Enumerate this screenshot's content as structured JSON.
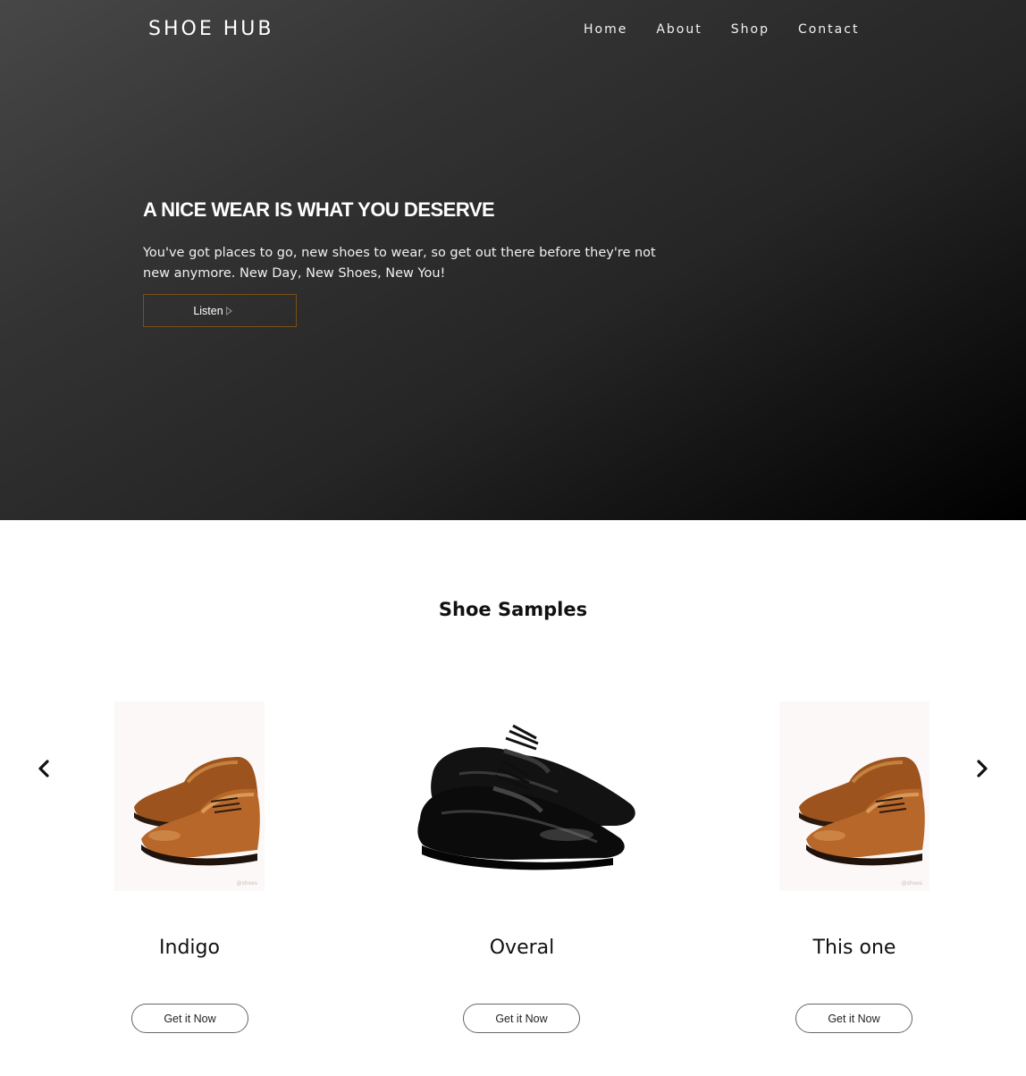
{
  "header": {
    "brand": "SHOE HUB",
    "nav": [
      "Home",
      "About",
      "Shop",
      "Contact"
    ]
  },
  "hero": {
    "title": "A NICE WEAR IS WHAT YOU DESERVE",
    "text": "You've got places to go, new shoes to wear, so get out there before they're not new anymore. New Day, New Shoes, New You!",
    "button_label": "Listen",
    "button_icon": "play-icon"
  },
  "samples": {
    "title": "Shoe Samples",
    "prev_icon": "chevron-left-icon",
    "next_icon": "chevron-right-icon",
    "products": [
      {
        "name": "Indigo",
        "button_label": "Get it Now",
        "image": "brown-oxford-shoes"
      },
      {
        "name": "Overal",
        "button_label": "Get it Now",
        "image": "black-oxford-shoes"
      },
      {
        "name": "This one",
        "button_label": "Get it Now",
        "image": "brown-oxford-shoes"
      }
    ]
  },
  "colors": {
    "hero_dark": "#000000",
    "hero_light": "#474747",
    "listen_border": "#7a5016",
    "text_dark": "#111111"
  }
}
